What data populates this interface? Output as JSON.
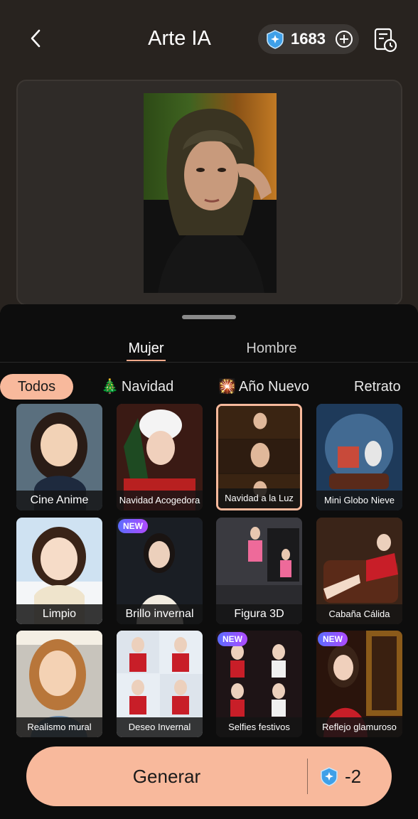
{
  "header": {
    "title": "Arte IA",
    "credits": "1683"
  },
  "tabs": {
    "gender": [
      {
        "label": "Mujer",
        "active": true
      },
      {
        "label": "Hombre",
        "active": false
      }
    ],
    "categories": [
      {
        "label": "Todos",
        "emoji": "",
        "active": true
      },
      {
        "label": "Navidad",
        "emoji": "🎄",
        "active": false
      },
      {
        "label": "Año Nuevo",
        "emoji": "🎇",
        "active": false
      },
      {
        "label": "Retrato",
        "emoji": "",
        "active": false
      }
    ]
  },
  "styles": [
    {
      "label": "Cine Anime",
      "new": false,
      "selected": false
    },
    {
      "label": "Navidad Acogedora",
      "new": false,
      "selected": false
    },
    {
      "label": "Navidad a la Luz",
      "new": false,
      "selected": true
    },
    {
      "label": "Mini Globo Nieve",
      "new": false,
      "selected": false
    },
    {
      "label": "Limpio",
      "new": false,
      "selected": false
    },
    {
      "label": "Brillo invernal",
      "new": true,
      "selected": false
    },
    {
      "label": "Figura 3D",
      "new": false,
      "selected": false
    },
    {
      "label": "Cabaña Cálida",
      "new": false,
      "selected": false
    },
    {
      "label": "Realismo mural",
      "new": false,
      "selected": false
    },
    {
      "label": "Deseo Invernal",
      "new": false,
      "selected": false
    },
    {
      "label": "Selfies festivos",
      "new": true,
      "selected": false
    },
    {
      "label": "Reflejo glamuroso",
      "new": true,
      "selected": false
    }
  ],
  "badge_label": "NEW",
  "generate": {
    "label": "Generar",
    "cost": "-2"
  },
  "colors": {
    "accent": "#f8b99c",
    "top_bg": "#28231f",
    "sheet_bg": "#0d0d0d",
    "gem": "#3fa0e8"
  }
}
